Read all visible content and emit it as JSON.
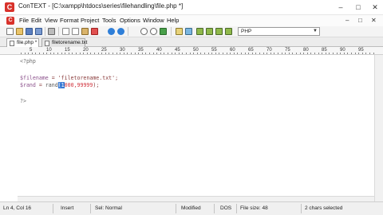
{
  "window": {
    "title": "ConTEXT - [C:\\xampp\\htdocs\\series\\filehandling\\file.php *]",
    "app_icon": "C",
    "minimize": "–",
    "maximize": "□",
    "close": "✕"
  },
  "menu": {
    "items": [
      "File",
      "Edit",
      "View",
      "Format",
      "Project",
      "Tools",
      "Options",
      "Window",
      "Help"
    ],
    "right_controls": [
      "–",
      "□",
      "✕"
    ]
  },
  "toolbar": {
    "language": "PHP",
    "icons": [
      "new-file-icon",
      "open-icon",
      "save-icon",
      "save-all-icon",
      "print-icon",
      "cut-icon",
      "copy-icon",
      "paste-icon",
      "delete-icon",
      "undo-icon",
      "redo-icon",
      "find-icon",
      "find-next-icon",
      "replace-icon",
      "ruler-icon",
      "word-wrap-icon",
      "exec-f9-icon",
      "exec-f10-icon",
      "exec-f11-icon",
      "exec-f12-icon"
    ]
  },
  "tabs": [
    {
      "label": "file.php *",
      "active": true
    },
    {
      "label": "filetorename.txt",
      "active": false
    }
  ],
  "ruler": {
    "numbers": [
      "5",
      "10",
      "15",
      "20",
      "25",
      "30",
      "35",
      "40",
      "45",
      "50",
      "55",
      "60",
      "65",
      "70",
      "75",
      "80",
      "85",
      "90",
      "95"
    ]
  },
  "code": {
    "line1": "<?php",
    "line3_var": "$filename",
    "line3_eq": " = ",
    "line3_str": "'filetorename.txt'",
    "line3_end": ";",
    "line4_var": "$rand",
    "line4_eq": " = ",
    "line4_fn": "rand",
    "line4_sel": "(1",
    "line4_rest": "000,99999",
    "line4_end": ");",
    "line6": "?>"
  },
  "status": {
    "position": "Ln 4, Col 16",
    "mode": "Insert",
    "sel": "Sel: Normal",
    "modified": "Modified",
    "format": "DOS",
    "size": "File size: 48",
    "selected": "2 chars selected"
  }
}
